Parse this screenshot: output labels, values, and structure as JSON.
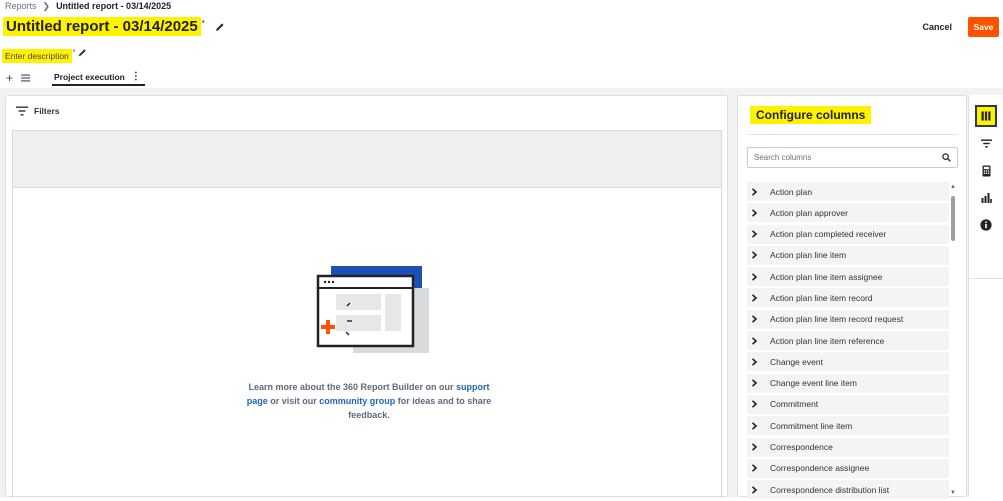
{
  "breadcrumb": {
    "parent": "Reports",
    "separator": "❯",
    "current": "Untitled report - 03/14/2025"
  },
  "report": {
    "title": "Untitled report - 03/14/2025",
    "title_marker": "*",
    "description_placeholder": "Enter description",
    "description_marker": "*"
  },
  "actions": {
    "cancel_label": "Cancel",
    "save_label": "Save"
  },
  "tabs": {
    "add_label": "+",
    "active_tab": "Project execution",
    "tab_menu": "⋮"
  },
  "report_panel": {
    "filters_label": "Filters",
    "help": {
      "part1": "Learn more about the 360 Report Builder on our ",
      "link1": "support page",
      "part2": " or visit our ",
      "link2": "community group",
      "part3": " for ideas and to share feedback."
    }
  },
  "config": {
    "title": "Configure columns",
    "search_placeholder": "Search columns",
    "columns": [
      "Action plan",
      "Action plan approver",
      "Action plan completed receiver",
      "Action plan line item",
      "Action plan line item assignee",
      "Action plan line item record",
      "Action plan line item record request",
      "Action plan line item reference",
      "Change event",
      "Change event line item",
      "Commitment",
      "Commitment line item",
      "Correspondence",
      "Correspondence assignee",
      "Correspondence distribution list"
    ]
  },
  "rail": {
    "icons": [
      "columns-icon",
      "filter-icon",
      "calculator-icon",
      "bar-chart-icon",
      "info-icon"
    ],
    "active": "columns-icon"
  },
  "colors": {
    "accent": "#ff5200",
    "highlight": "#fff200",
    "link": "#2066b8",
    "illustration_blue": "#1e4fb5"
  }
}
